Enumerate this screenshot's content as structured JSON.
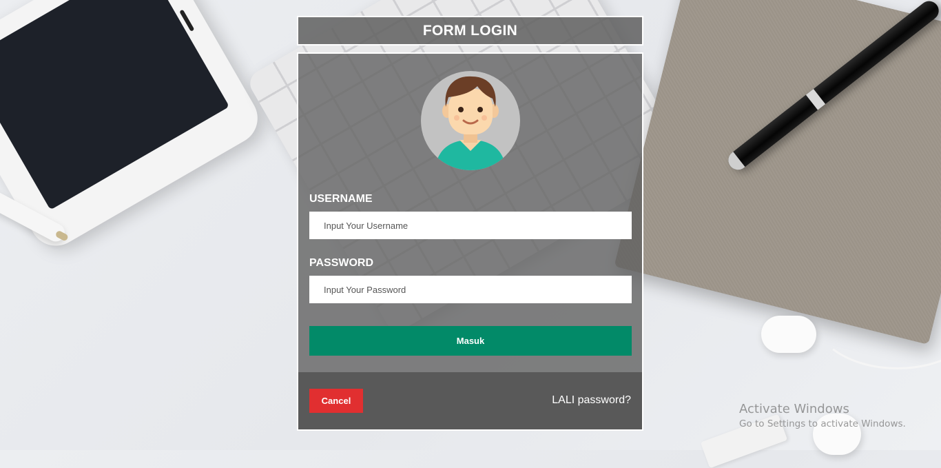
{
  "form": {
    "title": "FORM LOGIN",
    "username": {
      "label": "USERNAME",
      "placeholder": "Input Your Username",
      "value": ""
    },
    "password": {
      "label": "PASSWORD",
      "placeholder": "Input Your Password",
      "value": ""
    },
    "submit_label": "Masuk",
    "cancel_label": "Cancel",
    "forgot_label": "LALI password?"
  },
  "watermark": {
    "title": "Activate Windows",
    "subtitle": "Go to Settings to activate Windows."
  },
  "colors": {
    "submit": "#028a68",
    "cancel": "#e12f30",
    "panel": "#5f5f5f",
    "avatar_shirt": "#1fb8a0",
    "avatar_hair": "#6b3e26"
  },
  "icons": {
    "avatar": "user-avatar-icon"
  }
}
